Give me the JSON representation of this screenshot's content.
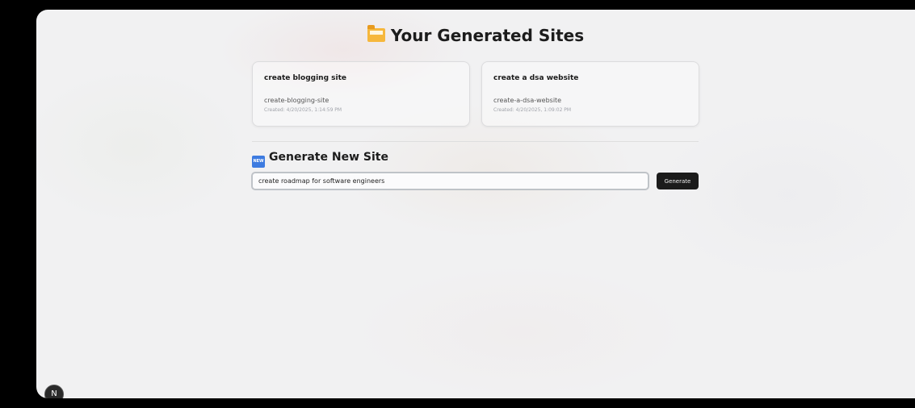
{
  "header": {
    "title": "Your Generated Sites",
    "icon": "folder-icon"
  },
  "sites": [
    {
      "name": "create blogging site",
      "slug": "create-blogging-site",
      "created": "Created: 4/20/2025, 1:14:59 PM"
    },
    {
      "name": "create a dsa website",
      "slug": "create-a-dsa-website",
      "created": "Created: 4/20/2025, 1:09:02 PM"
    }
  ],
  "generate": {
    "title": "Generate New Site",
    "icon_label": "NEW",
    "input_value": "create roadmap for software engineers",
    "button_label": "Generate"
  },
  "badge": {
    "label": "N"
  },
  "colors": {
    "button_bg": "#1b1b1b",
    "folder": "#f6b73c",
    "new_icon": "#3d7be0"
  }
}
